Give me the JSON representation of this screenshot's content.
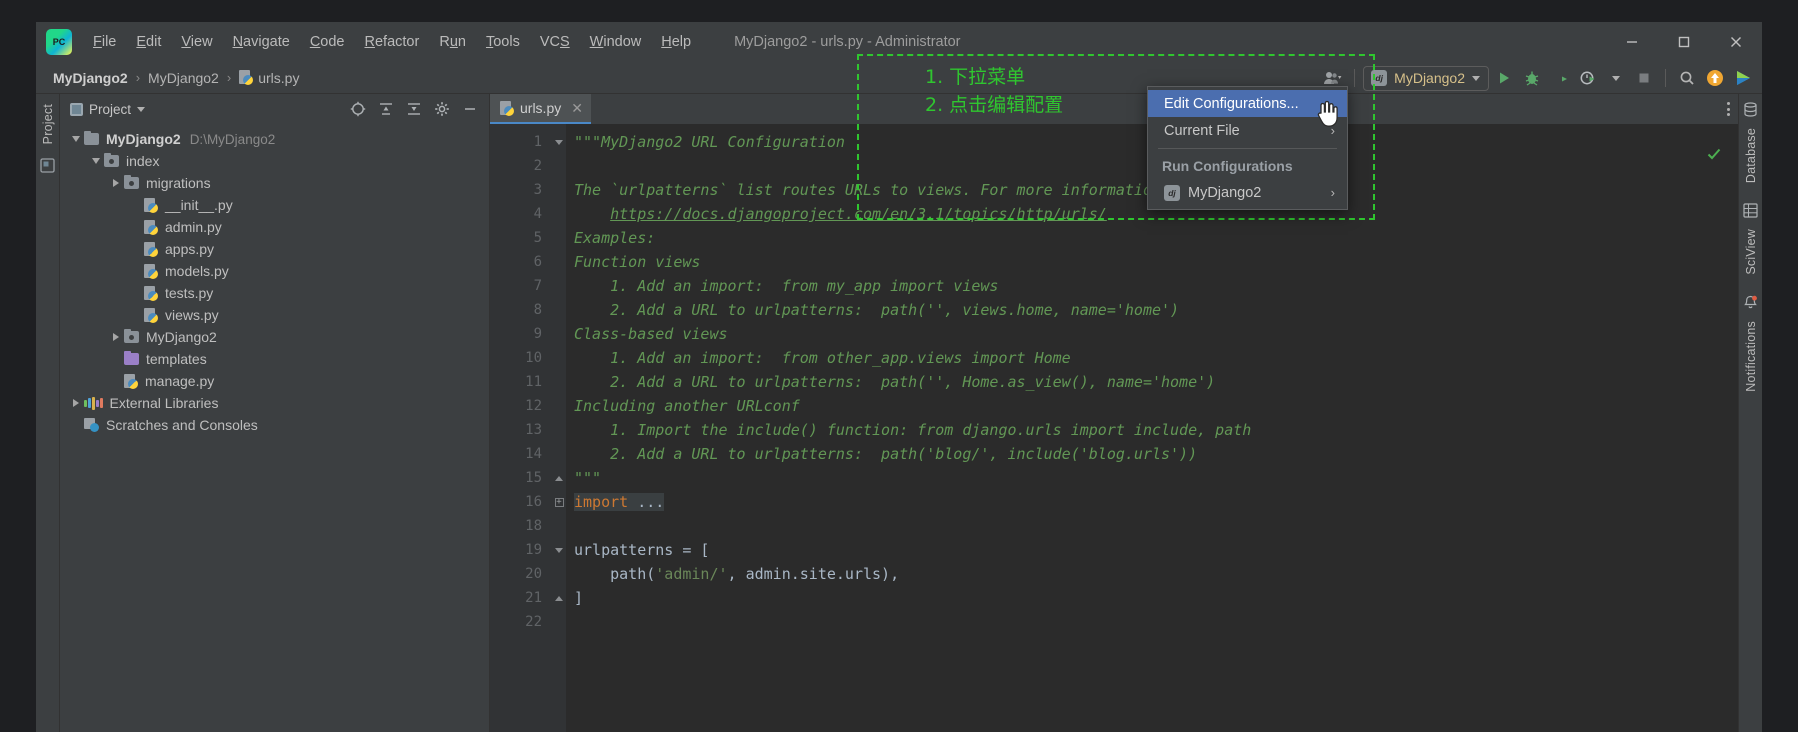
{
  "window": {
    "title": "MyDjango2 - urls.py - Administrator",
    "app_icon": "pycharm-logo-icon",
    "controls": [
      "minimize-icon",
      "maximize-icon",
      "close-icon"
    ]
  },
  "menubar": {
    "items": [
      {
        "label": "File",
        "mnemonic": "F"
      },
      {
        "label": "Edit",
        "mnemonic": "E"
      },
      {
        "label": "View",
        "mnemonic": "V"
      },
      {
        "label": "Navigate",
        "mnemonic": "N"
      },
      {
        "label": "Code",
        "mnemonic": "C"
      },
      {
        "label": "Refactor",
        "mnemonic": "R"
      },
      {
        "label": "Run",
        "mnemonic": "u"
      },
      {
        "label": "Tools",
        "mnemonic": "T"
      },
      {
        "label": "VCS",
        "mnemonic": "S"
      },
      {
        "label": "Window",
        "mnemonic": "W"
      },
      {
        "label": "Help",
        "mnemonic": "H"
      }
    ]
  },
  "breadcrumb": {
    "items": [
      {
        "label": "MyDjango2",
        "bold": true,
        "icon": ""
      },
      {
        "label": "MyDjango2",
        "bold": false,
        "icon": ""
      },
      {
        "label": "urls.py",
        "bold": false,
        "icon": "python-file-icon"
      }
    ],
    "separator": "›"
  },
  "toolbar": {
    "account_icon": "user-account-icon",
    "run_config": {
      "icon": "django-icon",
      "label": "MyDjango2",
      "dropdown_icon": "chevron-down-icon"
    },
    "buttons": [
      {
        "name": "run-button",
        "icon": "play-icon",
        "color": "#59a869"
      },
      {
        "name": "debug-button",
        "icon": "bug-icon",
        "color": "#59a869"
      },
      {
        "name": "run-coverage-button",
        "icon": "coverage-icon",
        "color": "#9aa0a6"
      },
      {
        "name": "run-with-profiler-button",
        "icon": "profiler-icon",
        "color": "#9aa0a6"
      },
      {
        "name": "stop-button",
        "icon": "stop-square-icon",
        "color": "#7a7d80"
      },
      {
        "name": "search-everywhere-button",
        "icon": "search-icon",
        "color": "#b0b0b0"
      },
      {
        "name": "update-project-button",
        "icon": "update-arrow-icon",
        "color": "#f0a732"
      },
      {
        "name": "ide-features-trainer-button",
        "icon": "play-colored-icon",
        "color": "#3ea7d8"
      }
    ]
  },
  "project_panel": {
    "title": "Project",
    "title_dropdown_icon": "chevron-down-icon",
    "header_buttons": [
      {
        "name": "locate-file-button",
        "icon": "crosshair-icon"
      },
      {
        "name": "expand-all-button",
        "icon": "expand-all-icon"
      },
      {
        "name": "collapse-all-button",
        "icon": "collapse-all-icon"
      },
      {
        "name": "settings-button",
        "icon": "gear-icon"
      },
      {
        "name": "hide-button",
        "icon": "minus-icon"
      }
    ],
    "tree": [
      {
        "label": "MyDjango2",
        "path": "D:\\MyDjango2",
        "depth": 0,
        "twisty": "open",
        "icon": "folder-icon",
        "bold": true
      },
      {
        "label": "index",
        "path": "",
        "depth": 1,
        "twisty": "open",
        "icon": "module-folder-icon",
        "bold": false
      },
      {
        "label": "migrations",
        "path": "",
        "depth": 2,
        "twisty": "closed",
        "icon": "module-folder-icon",
        "bold": false
      },
      {
        "label": "__init__.py",
        "path": "",
        "depth": 3,
        "twisty": "none",
        "icon": "python-file-icon",
        "bold": false
      },
      {
        "label": "admin.py",
        "path": "",
        "depth": 3,
        "twisty": "none",
        "icon": "python-file-icon",
        "bold": false
      },
      {
        "label": "apps.py",
        "path": "",
        "depth": 3,
        "twisty": "none",
        "icon": "python-file-icon",
        "bold": false
      },
      {
        "label": "models.py",
        "path": "",
        "depth": 3,
        "twisty": "none",
        "icon": "python-file-icon",
        "bold": false
      },
      {
        "label": "tests.py",
        "path": "",
        "depth": 3,
        "twisty": "none",
        "icon": "python-file-icon",
        "bold": false
      },
      {
        "label": "views.py",
        "path": "",
        "depth": 3,
        "twisty": "none",
        "icon": "python-file-icon",
        "bold": false
      },
      {
        "label": "MyDjango2",
        "path": "",
        "depth": 2,
        "twisty": "closed",
        "icon": "module-folder-icon",
        "bold": false
      },
      {
        "label": "templates",
        "path": "",
        "depth": 2,
        "twisty": "none",
        "icon": "templates-folder-icon",
        "bold": false
      },
      {
        "label": "manage.py",
        "path": "",
        "depth": 2,
        "twisty": "none",
        "icon": "python-file-icon",
        "bold": false
      },
      {
        "label": "External Libraries",
        "path": "",
        "depth": 0,
        "twisty": "closed",
        "icon": "external-libraries-icon",
        "bold": false
      },
      {
        "label": "Scratches and Consoles",
        "path": "",
        "depth": 0,
        "twisty": "none",
        "icon": "scratches-icon",
        "bold": false
      }
    ]
  },
  "left_rail": {
    "label": "Project",
    "structure_icon": "structure-icon"
  },
  "right_rail": {
    "items": [
      {
        "label": "Database",
        "icon": "database-icon"
      },
      {
        "label": "SciView",
        "icon": "sciview-icon"
      },
      {
        "label": "Notifications",
        "icon": "notifications-icon"
      }
    ]
  },
  "editor": {
    "tab": {
      "label": "urls.py",
      "icon": "python-file-icon",
      "close_icon": "close-icon"
    },
    "options_icon": "more-options-icon",
    "inspection_status_icon": "checkmark-ok-icon",
    "gutter_bulb_line": 20,
    "lines": [
      {
        "n": "1",
        "fold": "top",
        "html": "<span class=\"doc\">\"\"\"MyDjango2 URL Configuration</span>"
      },
      {
        "n": "2",
        "fold": "",
        "html": ""
      },
      {
        "n": "3",
        "fold": "",
        "html": "<span class=\"doc\">The `urlpatterns` list routes URLs to views. For more information please se</span>"
      },
      {
        "n": "4",
        "fold": "",
        "html": "<span class=\"doc\">    </span><span class=\"link\">https://docs.djangoproject.com/en/3.1/topics/http/urls/</span>"
      },
      {
        "n": "5",
        "fold": "",
        "html": "<span class=\"doc\">Examples:</span>"
      },
      {
        "n": "6",
        "fold": "",
        "html": "<span class=\"doc\">Function views</span>"
      },
      {
        "n": "7",
        "fold": "",
        "html": "<span class=\"doc\">    1. Add an import:  from my_app import views</span>"
      },
      {
        "n": "8",
        "fold": "",
        "html": "<span class=\"doc\">    2. Add a URL to urlpatterns:  path('', views.home, name='home')</span>"
      },
      {
        "n": "9",
        "fold": "",
        "html": "<span class=\"doc\">Class-based views</span>"
      },
      {
        "n": "10",
        "fold": "",
        "html": "<span class=\"doc\">    1. Add an import:  from other_app.views import Home</span>"
      },
      {
        "n": "11",
        "fold": "",
        "html": "<span class=\"doc\">    2. Add a URL to urlpatterns:  path('', Home.as_view(), name='home')</span>"
      },
      {
        "n": "12",
        "fold": "",
        "html": "<span class=\"doc\">Including another URLconf</span>"
      },
      {
        "n": "13",
        "fold": "",
        "html": "<span class=\"doc\">    1. Import the include() function: from django.urls import include, path</span>"
      },
      {
        "n": "14",
        "fold": "",
        "html": "<span class=\"doc\">    2. Add a URL to urlpatterns:  path('blog/', include('blog.urls'))</span>"
      },
      {
        "n": "15",
        "fold": "bot",
        "html": "<span class=\"doc\">\"\"\"</span>"
      },
      {
        "n": "16",
        "fold": "plus",
        "html": "<span class=\"hl-import\"><span class=\"kw\">import</span> <span class=\"fn\">...</span></span>"
      },
      {
        "n": "18",
        "fold": "",
        "html": ""
      },
      {
        "n": "19",
        "fold": "top",
        "html": "urlpatterns = ["
      },
      {
        "n": "20",
        "fold": "",
        "html": "    path(<span class=\"str\">'admin/'</span>, admin.site.urls),"
      },
      {
        "n": "21",
        "fold": "bot",
        "html": "]"
      },
      {
        "n": "22",
        "fold": "",
        "html": ""
      }
    ]
  },
  "dropdown_menu": {
    "items": [
      {
        "label": "Edit Configurations...",
        "selected": true,
        "icon": "",
        "submenu": false
      },
      {
        "label": "Current File",
        "selected": false,
        "icon": "",
        "submenu": true
      },
      {
        "type": "separator"
      },
      {
        "label": "Run Configurations",
        "type": "header"
      },
      {
        "label": "MyDjango2",
        "selected": false,
        "icon": "django-icon",
        "submenu": true
      }
    ],
    "submenu_arrow": "›",
    "cursor_icon": "hand-pointer-cursor"
  },
  "annotations": {
    "color": "#2fc62f",
    "line1": "1. 下拉菜单",
    "line2": "2. 点击编辑配置"
  }
}
